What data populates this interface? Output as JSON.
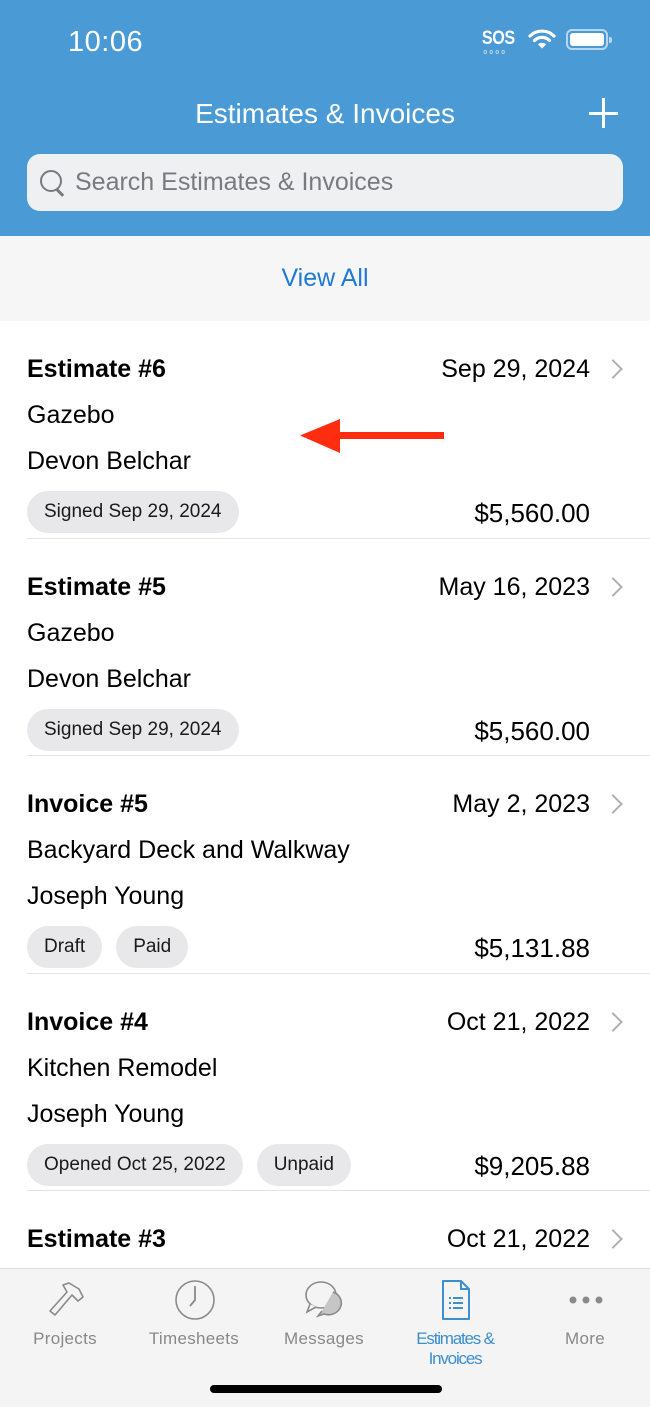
{
  "status_bar": {
    "time": "10:06",
    "sos": "SOS",
    "icons": [
      "wifi-icon",
      "battery-icon"
    ]
  },
  "header": {
    "title": "Estimates & Invoices",
    "add_icon": "plus-icon"
  },
  "search": {
    "placeholder": "Search Estimates & Invoices",
    "value": ""
  },
  "view_all": "View All",
  "items": [
    {
      "title": "Estimate #6",
      "date": "Sep 29, 2024",
      "project": "Gazebo",
      "client": "Devon Belchar",
      "badges": [
        "Signed Sep 29, 2024"
      ],
      "amount": "$5,560.00"
    },
    {
      "title": "Estimate #5",
      "date": "May 16, 2023",
      "project": "Gazebo",
      "client": "Devon Belchar",
      "badges": [
        "Signed Sep 29, 2024"
      ],
      "amount": "$5,560.00"
    },
    {
      "title": "Invoice #5",
      "date": "May 2, 2023",
      "project": "Backyard Deck and Walkway",
      "client": "Joseph Young",
      "badges": [
        "Draft",
        "Paid"
      ],
      "amount": "$5,131.88"
    },
    {
      "title": "Invoice #4",
      "date": "Oct 21, 2022",
      "project": "Kitchen Remodel",
      "client": "Joseph Young",
      "badges": [
        "Opened Oct 25, 2022",
        "Unpaid"
      ],
      "amount": "$9,205.88"
    },
    {
      "title": "Estimate #3",
      "date": "Oct 21, 2022"
    }
  ],
  "annotation": {
    "type": "arrow",
    "direction": "left",
    "color": "#ff2d0f"
  },
  "tabbar": {
    "tabs": [
      {
        "label": "Projects",
        "icon": "hammer-icon",
        "active": false
      },
      {
        "label": "Timesheets",
        "icon": "clock-icon",
        "active": false
      },
      {
        "label": "Messages",
        "icon": "chat-bubbles-icon",
        "active": false
      },
      {
        "label": "Estimates & Invoices",
        "icon": "document-icon",
        "active": true
      },
      {
        "label": "More",
        "icon": "more-dots-icon",
        "active": false
      }
    ]
  },
  "colors": {
    "header": "#4a9ad6",
    "accent": "#1f7ad6",
    "tab_active": "#3d8fd0",
    "badge_bg": "#e8e8ea"
  }
}
